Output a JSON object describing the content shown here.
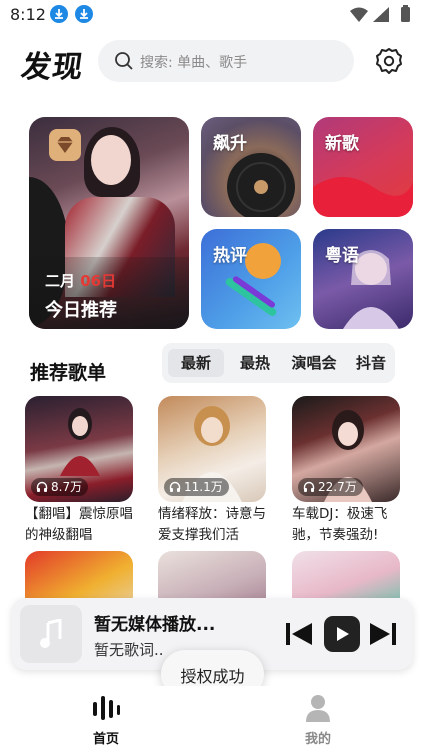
{
  "status_bar": {
    "time": "8:12"
  },
  "header": {
    "title": "发现",
    "search_placeholder": "搜索: 单曲、歌手"
  },
  "featured": {
    "date_prefix": "二月",
    "date_day": "06日",
    "title": "今日推荐"
  },
  "category_tiles": [
    {
      "label": "飙升"
    },
    {
      "label": "新歌"
    },
    {
      "label": "热评"
    },
    {
      "label": "粤语"
    }
  ],
  "recommend": {
    "title": "推荐歌单",
    "tabs": [
      "最新",
      "最热",
      "演唱会",
      "抖音"
    ],
    "active_tab": "最新"
  },
  "playlists": [
    {
      "count": "8.7万",
      "title": "【翻唱】震惊原唱的神级翻唱"
    },
    {
      "count": "11.1万",
      "title": "情绪释放：诗意与爱支撑我们活"
    },
    {
      "count": "22.7万",
      "title": "车载DJ：极速飞驰，节奏强劲!"
    }
  ],
  "player": {
    "title": "暂无媒体播放...",
    "subtitle": "暂无歌词.."
  },
  "toast": {
    "text": "授权成功"
  },
  "bottom_nav": [
    {
      "label": "首页",
      "active": true
    },
    {
      "label": "我的",
      "active": false
    }
  ],
  "colors": {
    "accent": "#111111",
    "muted": "#8a8a8a",
    "date_red": "#e53935",
    "download_blue": "#1e88e5"
  }
}
